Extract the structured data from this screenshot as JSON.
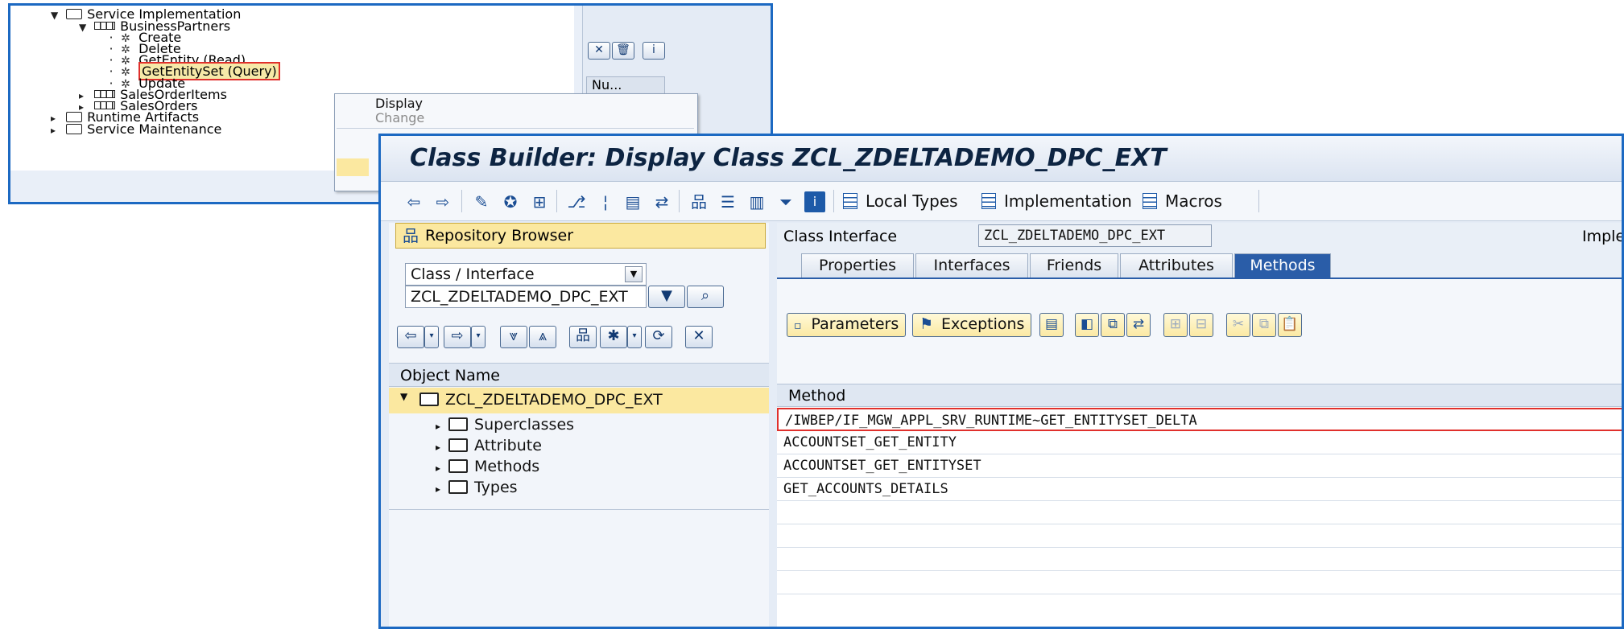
{
  "back_window": {
    "tree": [
      {
        "label": "Service Implementation",
        "kind": "folder-open",
        "expander": "down"
      },
      {
        "label": "BusinessPartners",
        "kind": "entity",
        "expander": "down"
      },
      {
        "label": "Create",
        "kind": "operation"
      },
      {
        "label": "Delete",
        "kind": "operation"
      },
      {
        "label": "GetEntity (Read)",
        "kind": "operation"
      },
      {
        "label": "GetEntitySet (Query)",
        "kind": "operation",
        "selected": true
      },
      {
        "label": "Update",
        "kind": "operation"
      },
      {
        "label": "SalesOrderItems",
        "kind": "entity",
        "expander": "right"
      },
      {
        "label": "SalesOrders",
        "kind": "entity",
        "expander": "right"
      },
      {
        "label": "Runtime Artifacts",
        "kind": "folder",
        "expander": "right"
      },
      {
        "label": "Service Maintenance",
        "kind": "folder",
        "expander": "right"
      }
    ],
    "right_pane": {
      "column_header": "Nu..."
    },
    "context_menu": {
      "items": [
        {
          "label": "Display",
          "enabled": true
        },
        {
          "label": "Change",
          "enabled": false
        }
      ]
    }
  },
  "class_builder": {
    "title": "Class Builder: Display Class ZCL_ZDELTADEMO_DPC_EXT",
    "toolbar": {
      "local_types": "Local Types",
      "implementation": "Implementation",
      "macros": "Macros"
    },
    "left": {
      "repo_browser": "Repository Browser",
      "object_type": "Class / Interface",
      "object_name": "ZCL_ZDELTADEMO_DPC_EXT",
      "column_header": "Object Name",
      "root": "ZCL_ZDELTADEMO_DPC_EXT",
      "children": [
        "Superclasses",
        "Attribute",
        "Methods",
        "Types"
      ]
    },
    "right": {
      "class_interface_label": "Class Interface",
      "class_interface_value": "ZCL_ZDELTADEMO_DPC_EXT",
      "impl_label": "Implem",
      "tabs": [
        "Properties",
        "Interfaces",
        "Friends",
        "Attributes",
        "Methods"
      ],
      "active_tab": "Methods",
      "parameters_btn": "Parameters",
      "exceptions_btn": "Exceptions",
      "method_header": "Method",
      "methods": [
        "/IWBEP/IF_MGW_APPL_SRV_RUNTIME~GET_ENTITYSET_DELTA",
        "ACCOUNTSET_GET_ENTITY",
        "ACCOUNTSET_GET_ENTITYSET",
        "GET_ACCOUNTS_DETAILS"
      ]
    }
  },
  "colors": {
    "accent": "#1c69c2",
    "selection": "#fbe8a0",
    "highlight_border": "#e0302c"
  }
}
